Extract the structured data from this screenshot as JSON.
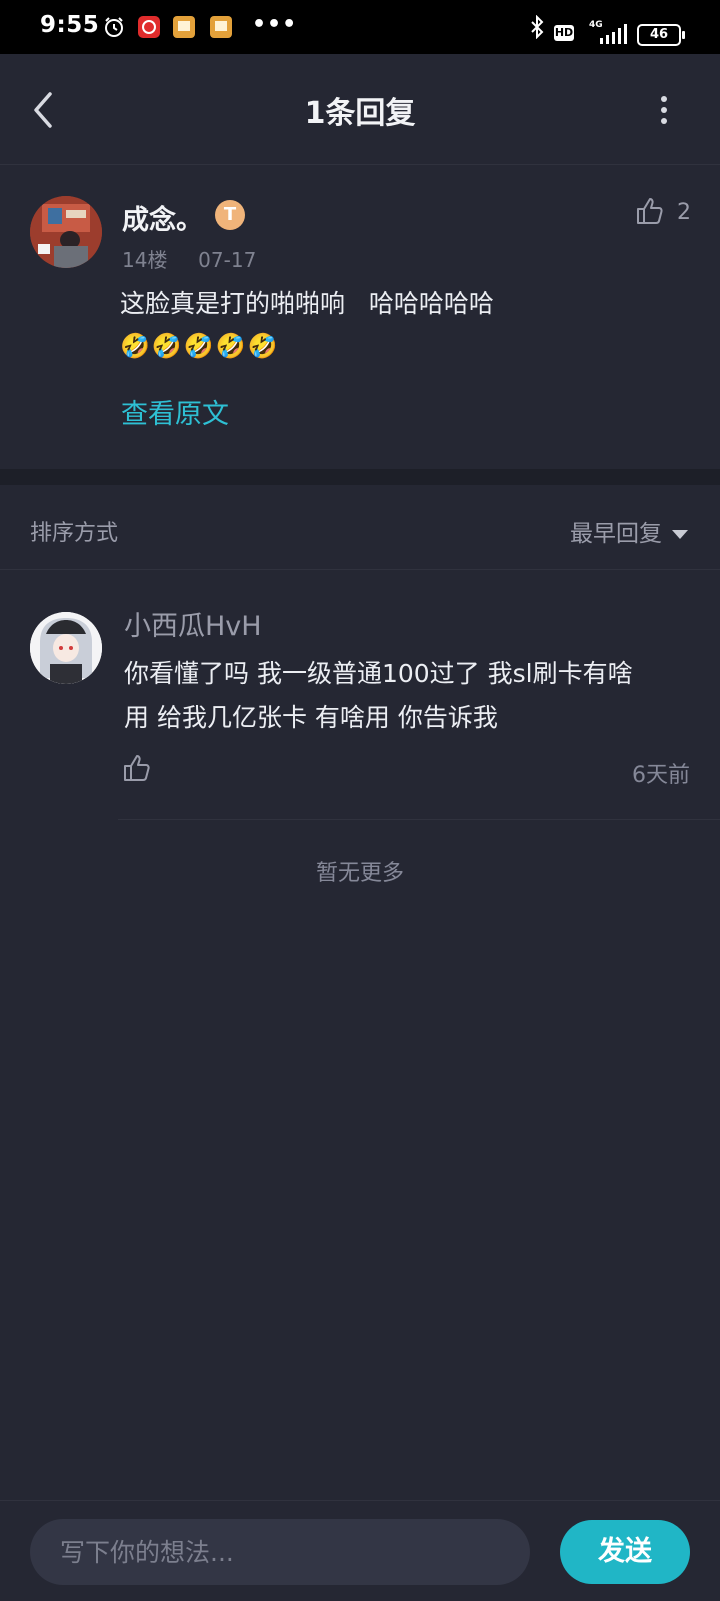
{
  "status_bar": {
    "time": "9:55",
    "battery": "46",
    "network": "4G",
    "hd": "HD"
  },
  "header": {
    "title": "1条回复"
  },
  "main_comment": {
    "username": "成念。",
    "badge": "T",
    "floor": "14楼",
    "date": "07-17",
    "text_line1": "这脸真是打的啪啪响   哈哈哈哈哈",
    "emojis": "🤣🤣🤣🤣🤣",
    "likes": "2",
    "view_original": "查看原文"
  },
  "sort": {
    "label": "排序方式",
    "selected": "最早回复"
  },
  "reply": {
    "username": "小西瓜HvH",
    "text_line1": "你看懂了吗 我一级普通100过了 我sl刷卡有啥",
    "text_line2": "用 给我几亿张卡 有啥用 你告诉我",
    "time": "6天前"
  },
  "footer": {
    "no_more": "暂无更多"
  },
  "composer": {
    "placeholder": "写下你的想法...",
    "send_label": "发送"
  },
  "colors": {
    "accent": "#20b6c6",
    "link": "#2ec0d4",
    "background": "#252733"
  }
}
